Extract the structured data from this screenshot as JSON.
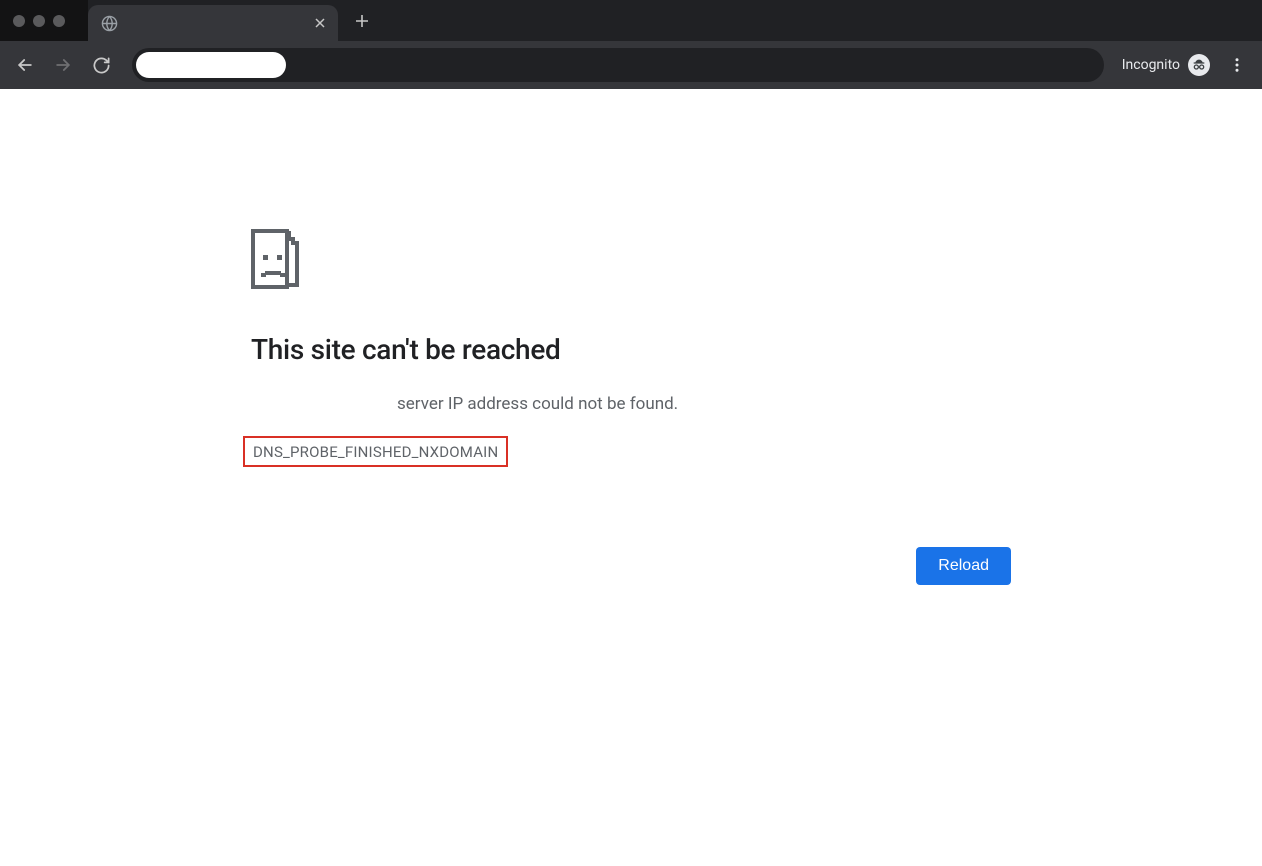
{
  "toolbar": {
    "incognito_label": "Incognito",
    "url_value": ""
  },
  "error": {
    "title": "This site can't be reached",
    "description": "server IP address could not be found.",
    "code": "DNS_PROBE_FINISHED_NXDOMAIN",
    "reload_label": "Reload"
  }
}
